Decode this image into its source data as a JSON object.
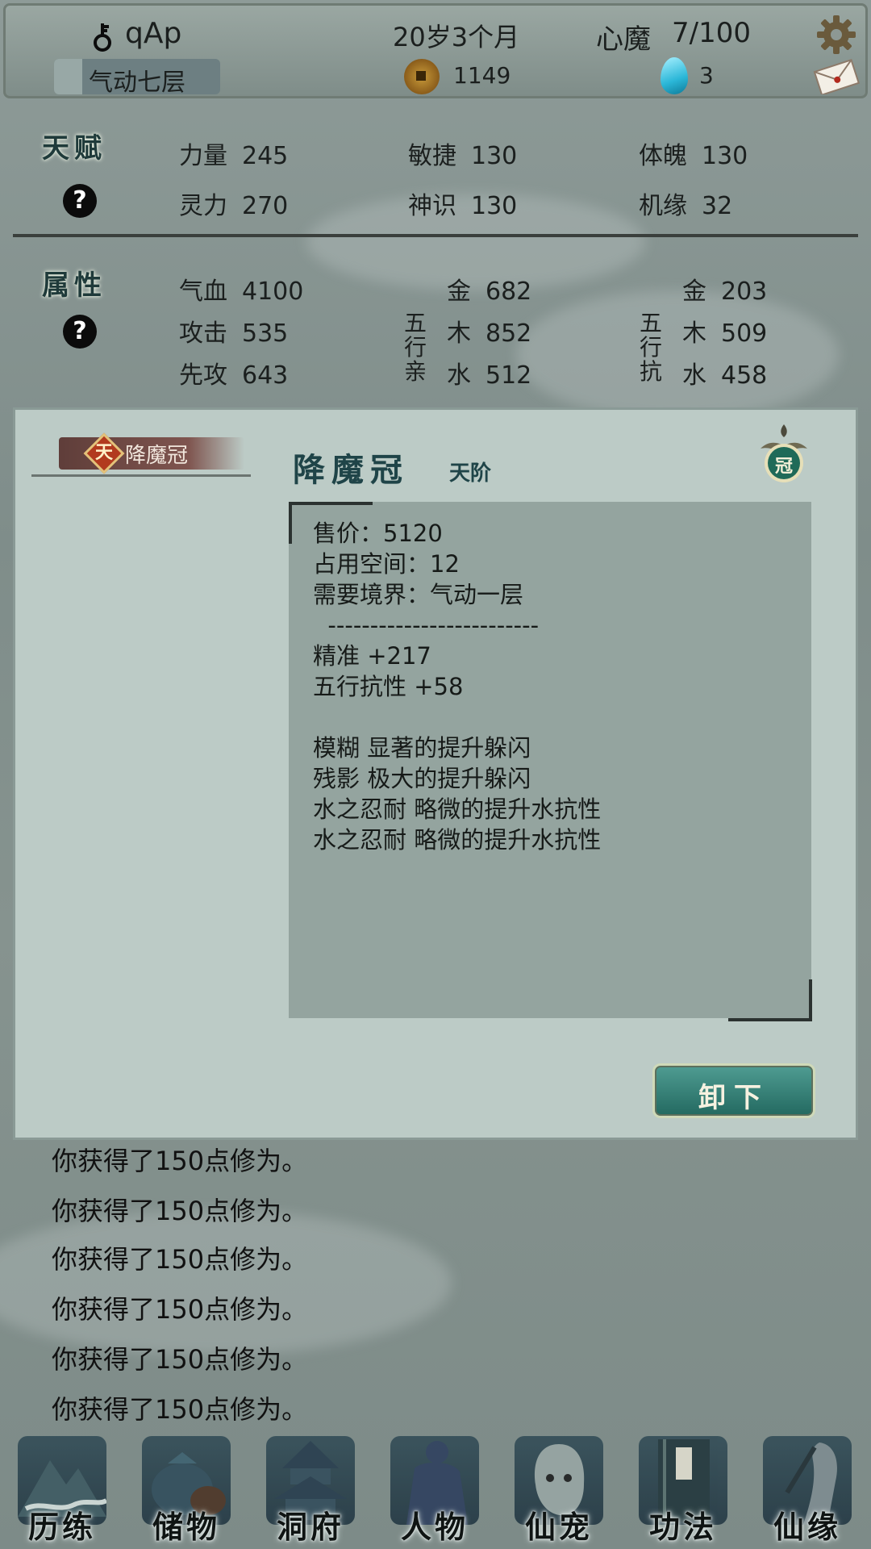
{
  "header": {
    "player_name": "qAp",
    "realm": "气动七层",
    "realm_progress": 0.17,
    "age": "20岁3个月",
    "coins": "1149",
    "heart_demon_label": "心魔",
    "heart_demon_value": "7/100",
    "gems": "3"
  },
  "talent": {
    "title": "天赋",
    "help": "?",
    "stats": [
      {
        "label": "力量",
        "value": "245"
      },
      {
        "label": "敏捷",
        "value": "130"
      },
      {
        "label": "体魄",
        "value": "130"
      },
      {
        "label": "灵力",
        "value": "270"
      },
      {
        "label": "神识",
        "value": "130"
      },
      {
        "label": "机缘",
        "value": "32"
      }
    ]
  },
  "attributes": {
    "title": "属性",
    "help": "?",
    "basic": [
      {
        "label": "气血",
        "value": "4100"
      },
      {
        "label": "攻击",
        "value": "535"
      },
      {
        "label": "先攻",
        "value": "643"
      }
    ],
    "affinity_label": "五行亲",
    "affinity": [
      {
        "label": "金",
        "value": "682"
      },
      {
        "label": "木",
        "value": "852"
      },
      {
        "label": "水",
        "value": "512"
      }
    ],
    "resist_label": "五行抗",
    "resist": [
      {
        "label": "金",
        "value": "203"
      },
      {
        "label": "木",
        "value": "509"
      },
      {
        "label": "水",
        "value": "458"
      }
    ]
  },
  "item_popup": {
    "tab_tier_char": "天",
    "tab_label": "降魔冠",
    "title": "降魔冠",
    "grade": "天阶",
    "slot_char": "冠",
    "lines": [
      "售价：5120",
      "占用空间：12",
      "需要境界：气动一层",
      "  -------------------------",
      "精准 +217",
      "五行抗性 +58",
      "",
      "模糊 显著的提升躲闪",
      "残影 极大的提升躲闪",
      "水之忍耐 略微的提升水抗性",
      "水之忍耐 略微的提升水抗性"
    ],
    "unequip_label": "卸下"
  },
  "log": [
    "你获得了150点修为。",
    "你获得了150点修为。",
    "你获得了150点修为。",
    "你获得了150点修为。",
    "你获得了150点修为。",
    "你获得了150点修为。"
  ],
  "nav": [
    {
      "label": "历练"
    },
    {
      "label": "储物"
    },
    {
      "label": "洞府"
    },
    {
      "label": "人物"
    },
    {
      "label": "仙宠"
    },
    {
      "label": "功法"
    },
    {
      "label": "仙缘"
    }
  ]
}
